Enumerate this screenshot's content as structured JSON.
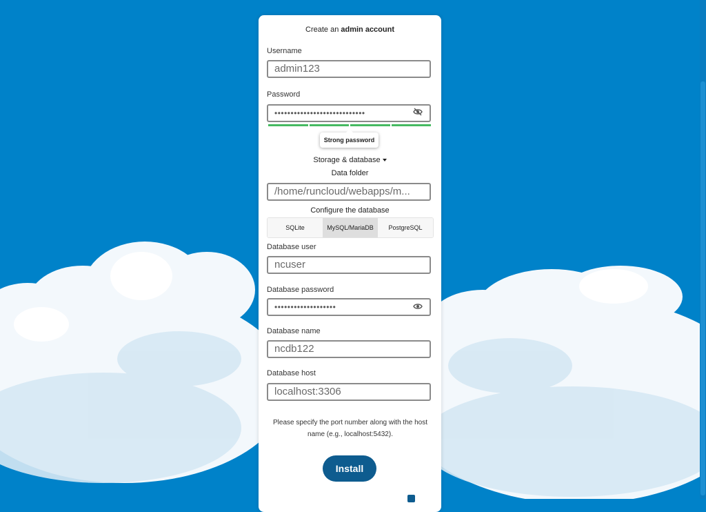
{
  "setup": {
    "heading_prefix": "Create an ",
    "heading_bold": "admin account",
    "username_label": "Username",
    "username_value": "admin123",
    "password_label": "Password",
    "password_value": "••••••••••••••••••••••••••••",
    "strength_text": "Strong password",
    "storage_toggle": "Storage & database",
    "data_folder_label": "Data folder",
    "data_folder_value": "/home/runcloud/webapps/m...",
    "configure_db_label": "Configure the database",
    "db_options": [
      "SQLite",
      "MySQL/MariaDB",
      "PostgreSQL"
    ],
    "db_selected": "MySQL/MariaDB",
    "db_user_label": "Database user",
    "db_user_value": "ncuser",
    "db_password_label": "Database password",
    "db_password_value": "•••••••••••••••••••",
    "db_name_label": "Database name",
    "db_name_value": "ncdb122",
    "db_host_label": "Database host",
    "db_host_value": "localhost:3306",
    "hint_text": "Please specify the port number along with the host name (e.g., localhost:5432).",
    "install_label": "Install"
  },
  "colors": {
    "sky": "#0082c9",
    "button": "#0e5c8f",
    "strength": "#46ba61"
  }
}
